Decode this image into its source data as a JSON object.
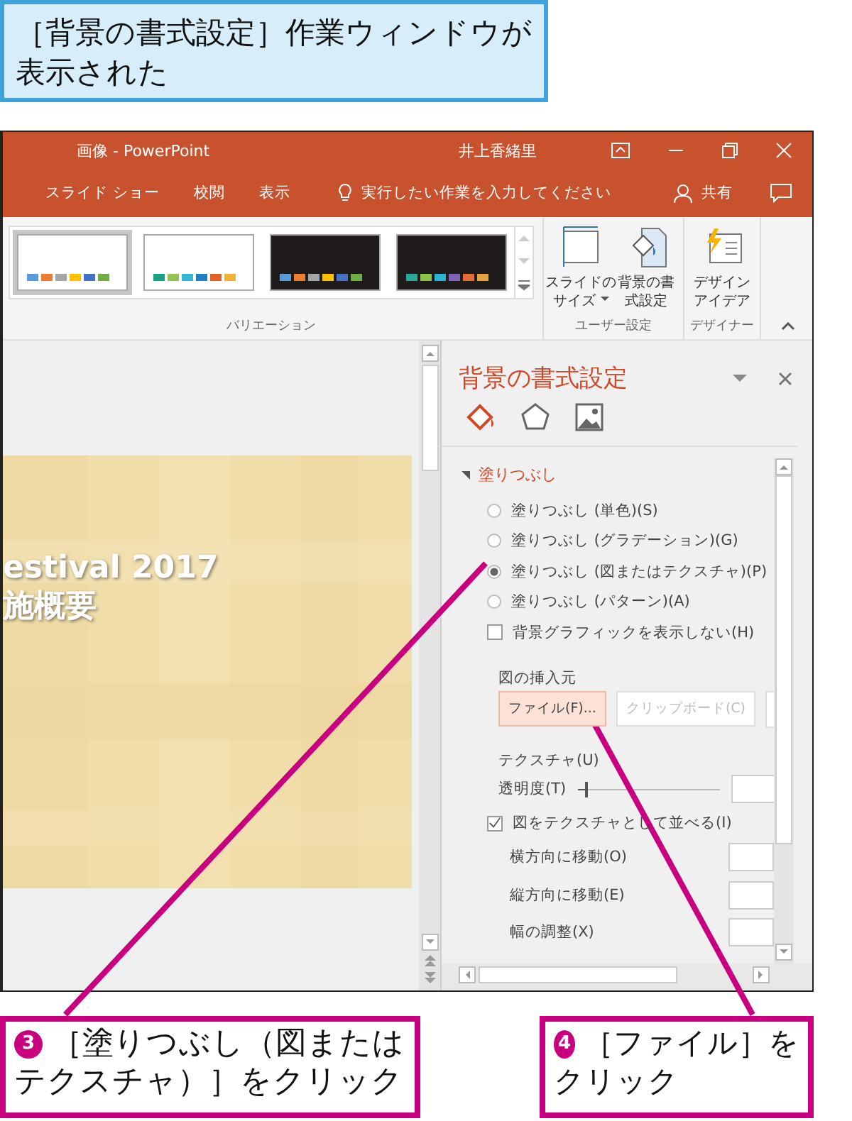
{
  "caption": {
    "text": "［背景の書式設定］作業ウィンドウが表示された"
  },
  "window": {
    "title": "画像 - PowerPoint",
    "user": "井上香緒里"
  },
  "tabs": [
    {
      "label": "スライド ショー"
    },
    {
      "label": "校閲"
    },
    {
      "label": "表示"
    }
  ],
  "tell_me": {
    "placeholder": "実行したい作業を入力してください"
  },
  "share": {
    "label": "共有"
  },
  "ribbon": {
    "variations": [
      {
        "kind": "light",
        "selected": true,
        "swatches": [
          {
            "color": "#5b9bd5"
          },
          {
            "color": "#ed7d31"
          },
          {
            "color": "#a5a5a5"
          },
          {
            "color": "#ffc000"
          },
          {
            "color": "#4472c4"
          },
          {
            "color": "#70ad47"
          }
        ]
      },
      {
        "kind": "light",
        "selected": false,
        "swatches": [
          {
            "color": "#1ba283"
          },
          {
            "color": "#93c353"
          },
          {
            "color": "#35b6d8"
          },
          {
            "color": "#1f7fc0"
          },
          {
            "color": "#e3622b"
          },
          {
            "color": "#f2b134"
          }
        ]
      },
      {
        "kind": "dark",
        "selected": false,
        "swatches": [
          {
            "color": "#5b9bd5"
          },
          {
            "color": "#ed7d31"
          },
          {
            "color": "#a5a5a5"
          },
          {
            "color": "#ffc000"
          },
          {
            "color": "#4472c4"
          },
          {
            "color": "#70ad47"
          }
        ]
      },
      {
        "kind": "dark",
        "selected": false,
        "swatches": [
          {
            "color": "#2aa89a"
          },
          {
            "color": "#8bc34a"
          },
          {
            "color": "#29b6d6"
          },
          {
            "color": "#7e64b5"
          },
          {
            "color": "#e36b3a"
          },
          {
            "color": "#e4a13f"
          }
        ]
      }
    ],
    "variations_label": "バリエーション",
    "buttons": [
      {
        "kind": "slide-size",
        "lines": [
          "スライドの",
          "サイズ"
        ],
        "dropdown": true
      },
      {
        "kind": "format-background",
        "lines": [
          "背景の書",
          "式設定"
        ],
        "dropdown": false
      },
      {
        "kind": "design-ideas",
        "lines": [
          "デザイン",
          "アイデア"
        ],
        "dropdown": false
      }
    ],
    "groups": [
      "ユーザー設定",
      "デザイナー"
    ]
  },
  "slide": {
    "title_lines": [
      "estival 2017",
      "施概要"
    ]
  },
  "pane": {
    "title": "背景の書式設定",
    "tabs": [
      {
        "kind": "fill",
        "selected": true
      },
      {
        "kind": "effects",
        "selected": false
      },
      {
        "kind": "picture",
        "selected": false
      }
    ],
    "section": {
      "label": "塗りつぶし",
      "expanded": true
    },
    "fill_options": [
      {
        "label": "塗りつぶし (単色)(S)",
        "selected": false
      },
      {
        "label": "塗りつぶし (グラデーション)(G)",
        "selected": false
      },
      {
        "label": "塗りつぶし (図またはテクスチャ)(P)",
        "selected": true
      },
      {
        "label": "塗りつぶし (パターン)(A)",
        "selected": false
      }
    ],
    "hide_graphics": {
      "label": "背景グラフィックを表示しない(H)",
      "checked": false
    },
    "insert_from": {
      "label": "図の挿入元",
      "buttons": [
        {
          "label": "ファイル(F)...",
          "focused": true,
          "disabled": false
        },
        {
          "label": "クリップボード(C)",
          "focused": false,
          "disabled": true
        }
      ]
    },
    "texture": {
      "label": "テクスチャ(U)"
    },
    "transparency": {
      "label": "透明度(T)",
      "level": 0.05
    },
    "tile": {
      "label": "図をテクスチャとして並べる(I)",
      "checked": true
    },
    "fields": [
      {
        "label": "横方向に移動(O)"
      },
      {
        "label": "縦方向に移動(E)"
      },
      {
        "label": "幅の調整(X)"
      }
    ]
  },
  "callouts": [
    {
      "step": "3",
      "lines": [
        "［塗りつぶし（図または",
        "テクスチャ）］をクリック"
      ]
    },
    {
      "step": "4",
      "lines": [
        "［ファイル］を",
        "クリック"
      ]
    }
  ]
}
